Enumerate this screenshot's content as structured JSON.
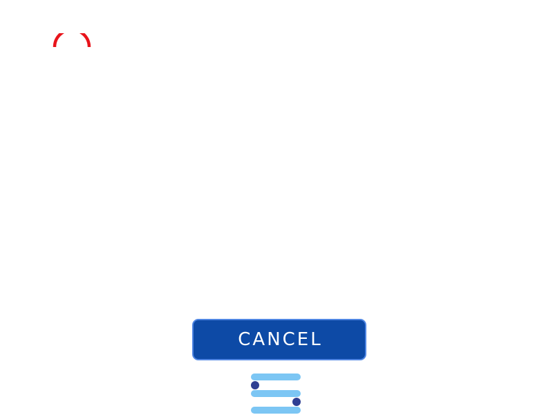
{
  "colors": {
    "background": "#ffffff",
    "spinner": "#e8141b",
    "button_bg": "#0d4aa6",
    "button_border": "#4f86e3",
    "button_text": "#ffffff",
    "slider_track": "#7cc6f4",
    "slider_knob": "#2f3f93"
  },
  "loading": {
    "icon": "loading-spinner-icon"
  },
  "dialog": {
    "cancel_label": "CANCEL"
  },
  "toolbar": {
    "icon": "sliders-icon"
  }
}
